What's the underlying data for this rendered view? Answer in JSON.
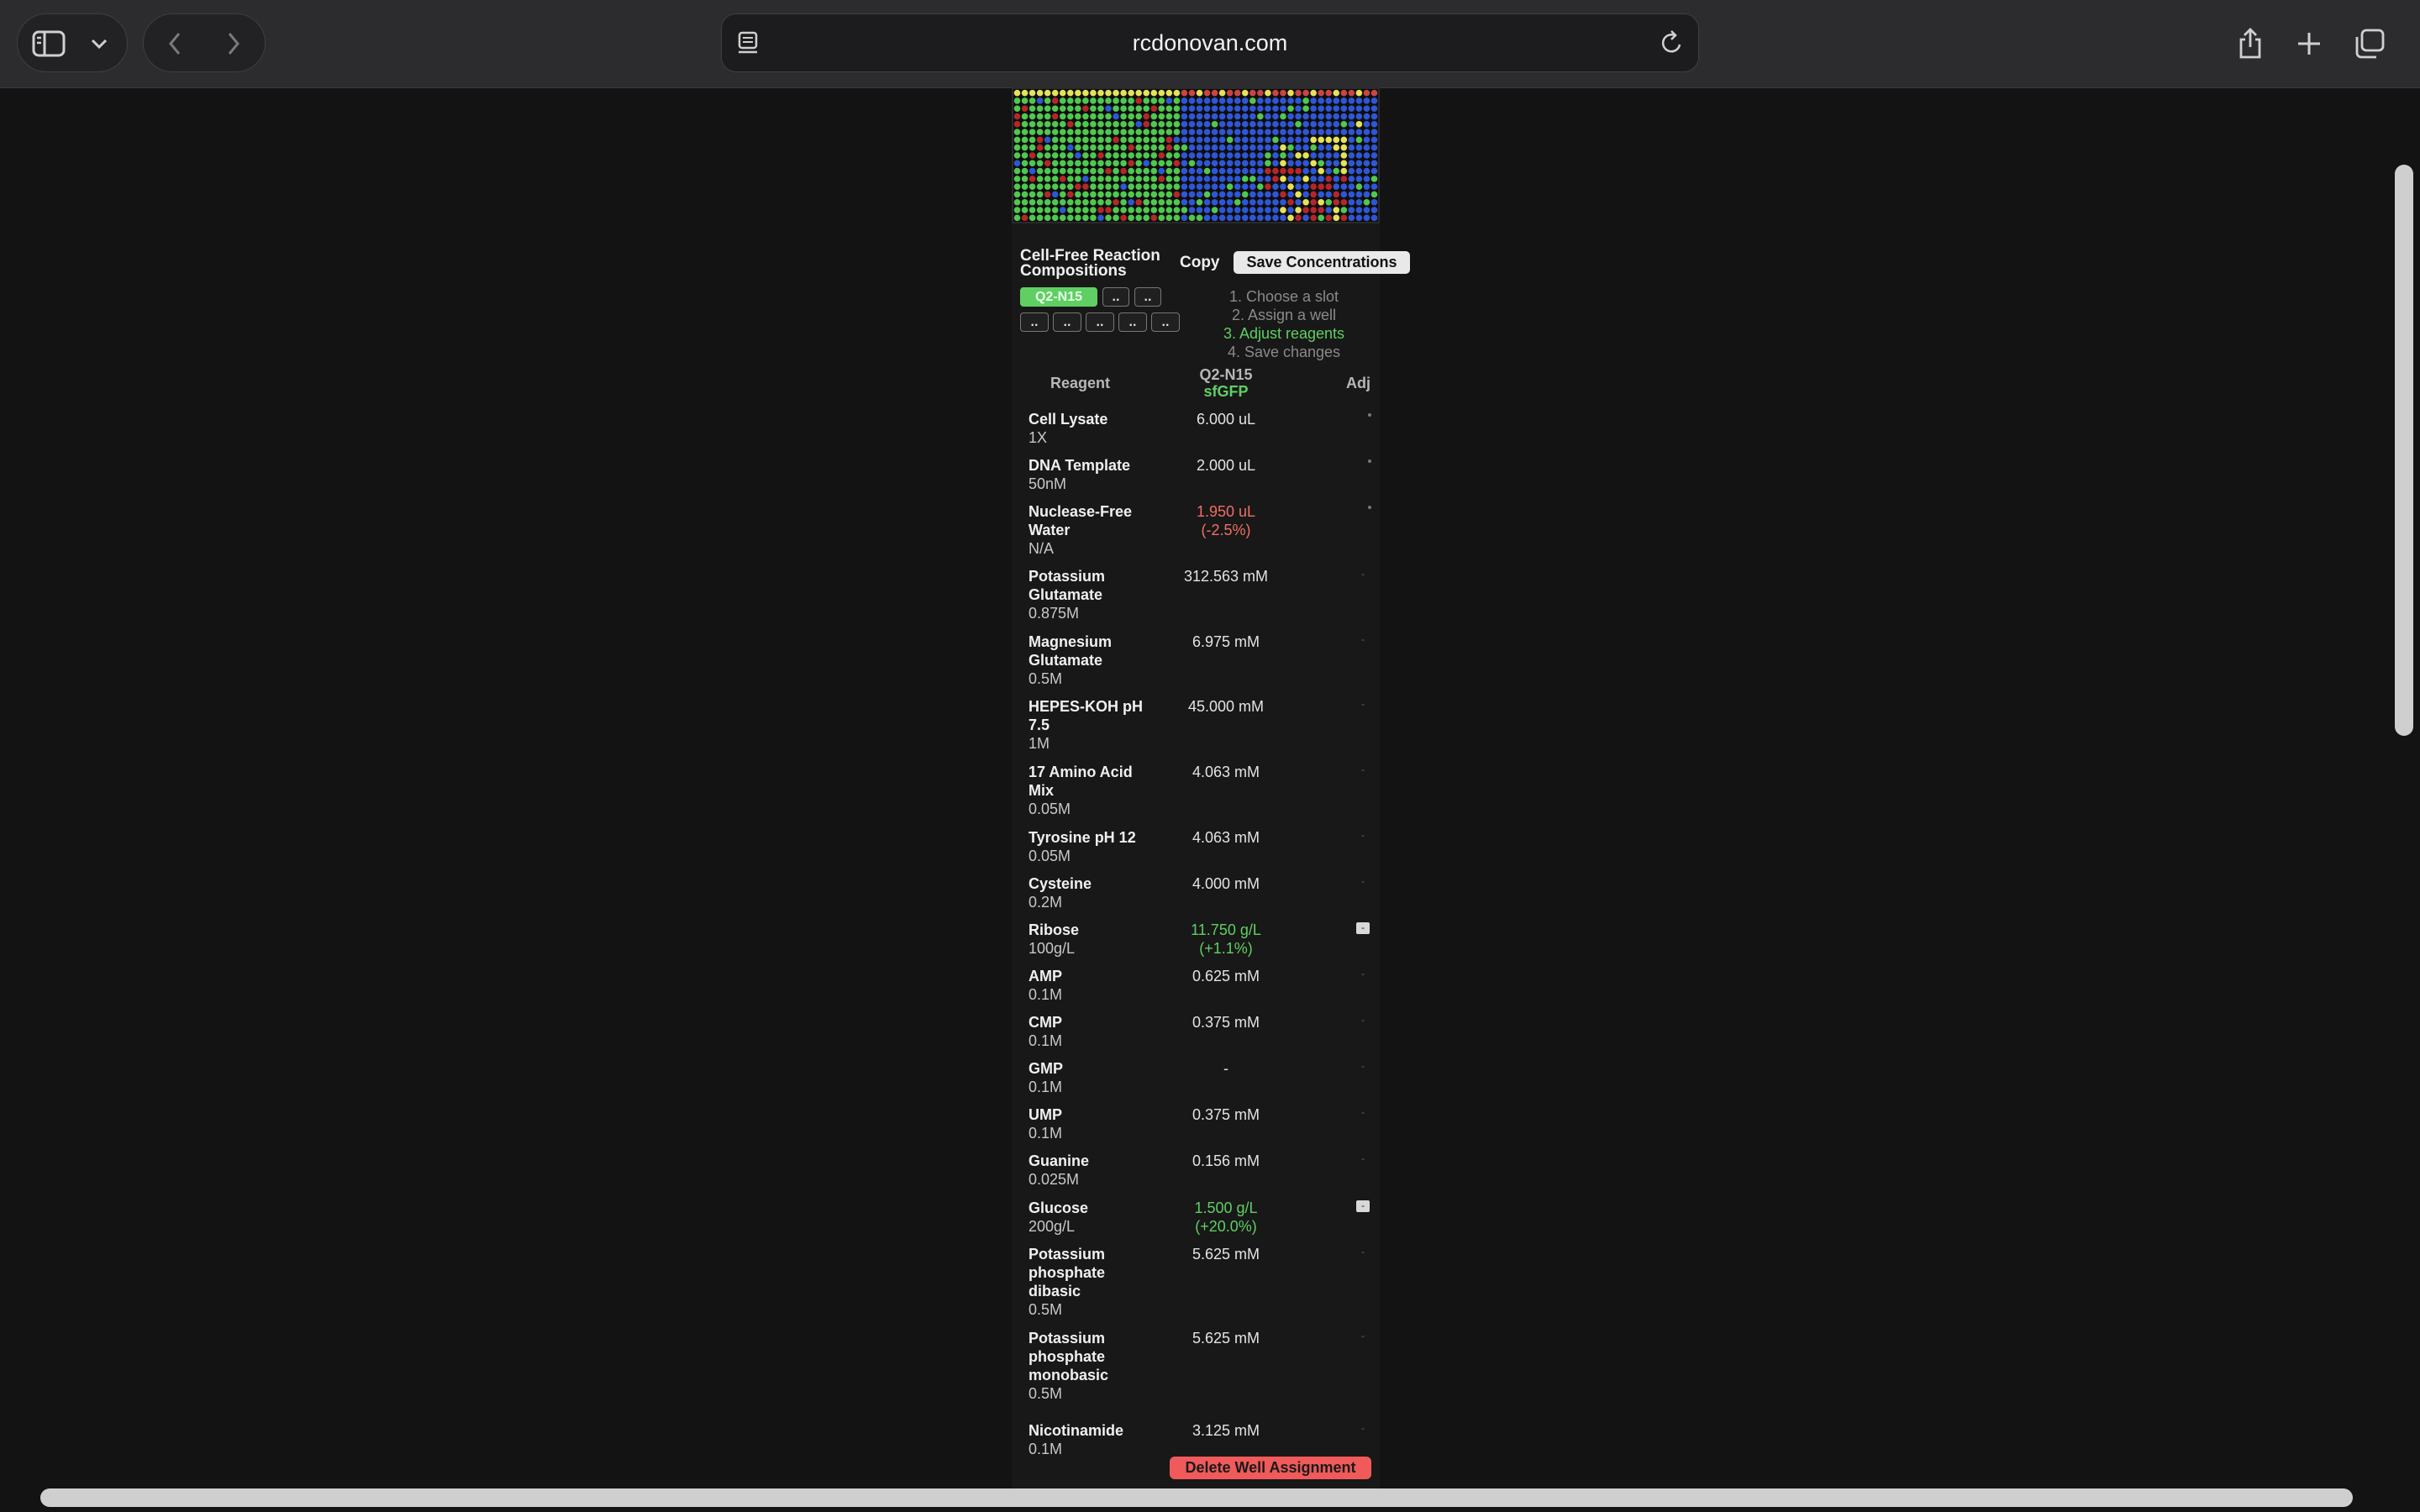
{
  "browser": {
    "url": "rcdonovan.com",
    "icons": [
      "sidebar-icon",
      "chevron-down-icon",
      "back-icon",
      "forward-icon",
      "page-menu-icon",
      "reload-icon",
      "share-icon",
      "new-tab-icon",
      "tabs-overview-icon"
    ]
  },
  "plate": {
    "wells_green": "#4fc84f",
    "wells_blue": "#2f56d6",
    "wells_yellow": "#e5e25a",
    "wells_red": "#b5262a"
  },
  "panel": {
    "title": "Cell-Free Reaction Compositions",
    "copy_label": "Copy",
    "save_label": "Save Concentrations",
    "slots_row1": [
      "Q2-N15",
      "..",
      ".."
    ],
    "slots_row2": [
      "..",
      "..",
      "..",
      "..",
      ".."
    ],
    "steps": [
      "1. Choose a slot",
      "2. Assign a well",
      "3. Adjust reagents",
      "4. Save changes"
    ],
    "current_step_index": 2,
    "headers": {
      "reagent": "Reagent",
      "slot_name": "Q2-N15",
      "slot_sub": "sfGFP",
      "adj": "Adj"
    },
    "delete_label": "Delete Well Assignment"
  },
  "reagents": [
    {
      "name": "Cell Lysate",
      "stock": "1X",
      "value": "6.000 uL",
      "delta": "",
      "status": "normal",
      "adj": "dot"
    },
    {
      "name": "DNA Template",
      "stock": "50nM",
      "value": "2.000 uL",
      "delta": "",
      "status": "normal",
      "adj": "dot"
    },
    {
      "name": "Nuclease-Free Water",
      "stock": "N/A",
      "value": "1.950 uL",
      "delta": "(-2.5%)",
      "status": "red",
      "adj": "dot"
    },
    {
      "name": "Potassium Glutamate",
      "stock": "0.875M",
      "value": "312.563 mM",
      "delta": "",
      "status": "normal",
      "adj": "off"
    },
    {
      "name": "Magnesium Glutamate",
      "stock": "0.5M",
      "value": "6.975 mM",
      "delta": "",
      "status": "normal",
      "adj": "off"
    },
    {
      "name": "HEPES-KOH pH 7.5",
      "stock": "1M",
      "value": "45.000 mM",
      "delta": "",
      "status": "normal",
      "adj": "off"
    },
    {
      "name": "17 Amino Acid Mix",
      "stock": "0.05M",
      "value": "4.063 mM",
      "delta": "",
      "status": "normal",
      "adj": "off"
    },
    {
      "name": "Tyrosine pH 12",
      "stock": "0.05M",
      "value": "4.063 mM",
      "delta": "",
      "status": "normal",
      "adj": "off"
    },
    {
      "name": "Cysteine",
      "stock": "0.2M",
      "value": "4.000 mM",
      "delta": "",
      "status": "normal",
      "adj": "off"
    },
    {
      "name": "Ribose",
      "stock": "100g/L",
      "value": "11.750 g/L",
      "delta": "(+1.1%)",
      "status": "green",
      "adj": "on"
    },
    {
      "name": "AMP",
      "stock": "0.1M",
      "value": "0.625 mM",
      "delta": "",
      "status": "normal",
      "adj": "off"
    },
    {
      "name": "CMP",
      "stock": "0.1M",
      "value": "0.375 mM",
      "delta": "",
      "status": "normal",
      "adj": "off"
    },
    {
      "name": "GMP",
      "stock": "0.1M",
      "value": "-",
      "delta": "",
      "status": "normal",
      "adj": "off"
    },
    {
      "name": "UMP",
      "stock": "0.1M",
      "value": "0.375 mM",
      "delta": "",
      "status": "normal",
      "adj": "off"
    },
    {
      "name": "Guanine",
      "stock": "0.025M",
      "value": "0.156 mM",
      "delta": "",
      "status": "normal",
      "adj": "off"
    },
    {
      "name": "Glucose",
      "stock": "200g/L",
      "value": "1.500 g/L",
      "delta": "(+20.0%)",
      "status": "green",
      "adj": "on"
    },
    {
      "name": "Potassium phosphate dibasic",
      "stock": "0.5M",
      "value": "5.625 mM",
      "delta": "",
      "status": "normal",
      "adj": "off"
    },
    {
      "name": "Potassium phosphate monobasic",
      "stock": "0.5M",
      "value": "5.625 mM",
      "delta": "",
      "status": "normal",
      "adj": "off"
    },
    {
      "name": "Nicotinamide",
      "stock": "0.1M",
      "value": "3.125 mM",
      "delta": "",
      "status": "normal",
      "adj": "off"
    }
  ]
}
